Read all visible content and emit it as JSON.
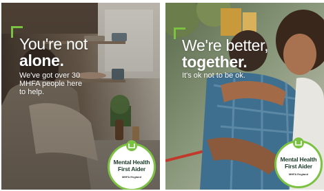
{
  "left_poster": {
    "headline_line1": "You're not",
    "headline_line2": "alone.",
    "subtext_line1": "We've got over 30",
    "subtext_line2": "MHFA people here",
    "subtext_line3": "to help.",
    "badge_title_line1": "Mental Health",
    "badge_title_line2": "First Aider",
    "badge_org": "MHFA England"
  },
  "right_poster": {
    "headline_line1": "We're better,",
    "headline_line2": "together.",
    "subtext": "It's ok not to be ok.",
    "badge_title_line1": "Mental Health",
    "badge_title_line2": "First Aider",
    "badge_org": "MHFA England"
  },
  "colors": {
    "accent_green": "#7cc242",
    "badge_text": "#1d3d2b"
  },
  "icons": [
    "corner-bracket-icon",
    "mhfa-logo-icon"
  ]
}
